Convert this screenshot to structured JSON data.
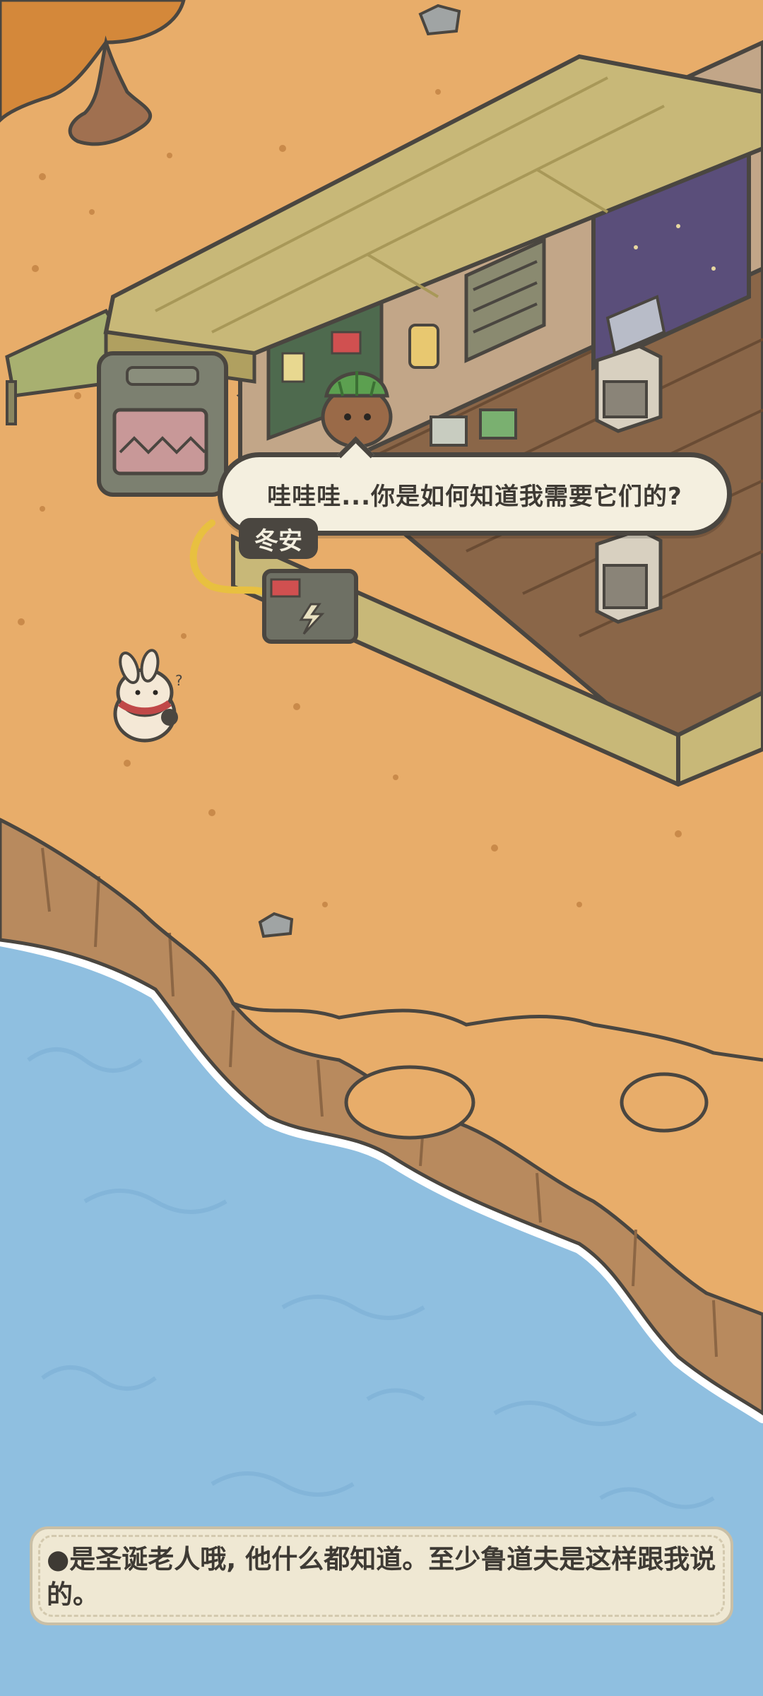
{
  "dialogue": {
    "line": "哇哇哇...你是如何知道我需要它们的?",
    "speaker": "冬安"
  },
  "narration": {
    "bullet": "●",
    "text": "是圣诞老人哦, 他什么都知道。至少鲁道夫是这样跟我说的。"
  },
  "colors": {
    "sand": "#e8ad6a",
    "water": "#8fbfe0",
    "cliff": "#b88a5e",
    "deck_wood": "#c8b878",
    "floor_wood": "#8a6648",
    "bubble": "#f4efdf",
    "outline": "#4a4640"
  }
}
